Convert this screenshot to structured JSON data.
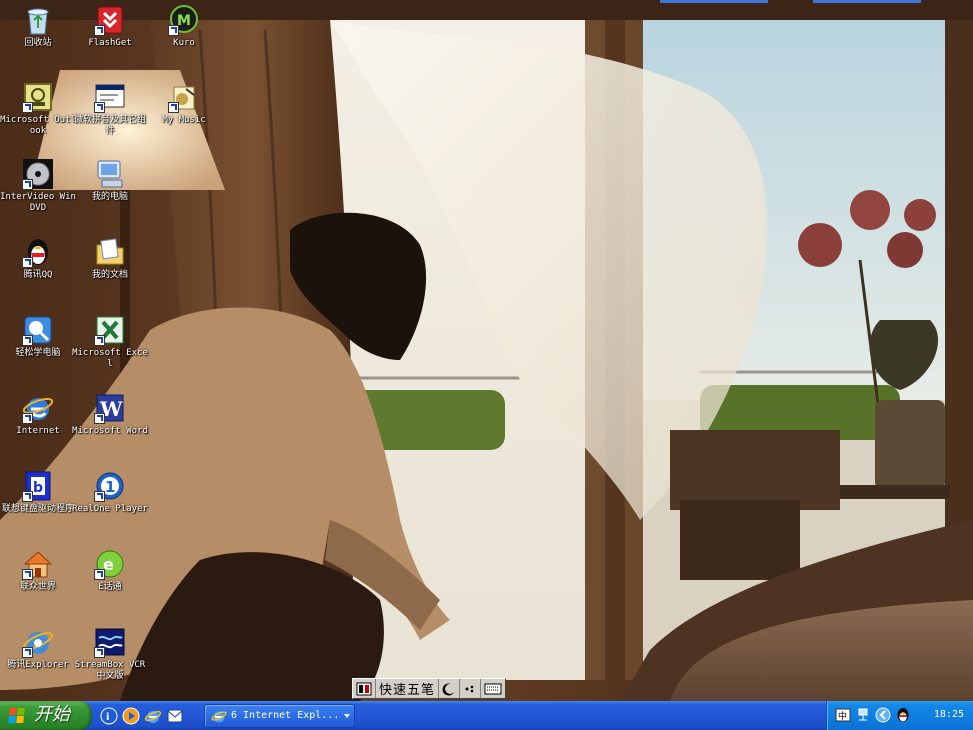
{
  "desktop": {
    "icons": [
      {
        "label": "回收站",
        "icon": "recycle-bin-icon",
        "shortcut": false
      },
      {
        "label": "FlashGet",
        "icon": "flashget-icon",
        "shortcut": true
      },
      {
        "label": "Kuro",
        "icon": "kuro-icon",
        "shortcut": true
      },
      {
        "label": "Microsoft Outlook",
        "icon": "outlook-icon",
        "shortcut": true
      },
      {
        "label": "微软拼音及其它组件",
        "icon": "ime-setup-icon",
        "shortcut": true
      },
      {
        "label": "My Music",
        "icon": "my-music-icon",
        "shortcut": true
      },
      {
        "label": "InterVideo WinDVD",
        "icon": "windvd-icon",
        "shortcut": true
      },
      {
        "label": "我的电脑",
        "icon": "my-computer-icon",
        "shortcut": false
      },
      {
        "label": "腾讯QQ",
        "icon": "qq-penguin-icon",
        "shortcut": true
      },
      {
        "label": "我的文档",
        "icon": "my-documents-icon",
        "shortcut": false
      },
      {
        "label": "轻松学电脑",
        "icon": "learn-computer-icon",
        "shortcut": true
      },
      {
        "label": "Microsoft Excel",
        "icon": "excel-icon",
        "shortcut": true
      },
      {
        "label": "Internet",
        "icon": "internet-explorer-icon",
        "shortcut": true
      },
      {
        "label": "Microsoft Word",
        "icon": "word-icon",
        "shortcut": true
      },
      {
        "label": "联想键盘驱动程序",
        "icon": "keyboard-driver-icon",
        "shortcut": true
      },
      {
        "label": "RealOne Player",
        "icon": "realone-icon",
        "shortcut": true
      },
      {
        "label": "联众世界",
        "icon": "ourgame-house-icon",
        "shortcut": true
      },
      {
        "label": "E话通",
        "icon": "ehuatong-icon",
        "shortcut": true
      },
      {
        "label": "腾讯Explorer",
        "icon": "tencent-explorer-icon",
        "shortcut": true
      },
      {
        "label": "StreamBox VCR 中文版",
        "icon": "streambox-icon",
        "shortcut": true
      }
    ]
  },
  "ime_bar": {
    "name": "快速五笔",
    "icons": [
      "ime-logo-icon",
      "half-moon-icon",
      "punctuation-icon",
      "soft-keyboard-icon"
    ]
  },
  "taskbar": {
    "start_label": "开始",
    "quick_launch": [
      "qq-launch-icon",
      "media-player-icon",
      "internet-explorer-icon",
      "outlook-express-icon"
    ],
    "task_button_label": "6 Internet Expl...",
    "tray_icons": [
      "input-method-icon",
      "network-icon",
      "arrow-icon",
      "qq-penguin-icon"
    ],
    "clock": "18:25"
  },
  "colors": {
    "taskbar": "#245edb",
    "start_button": "#3c9d3a",
    "tray": "#0f80e2"
  }
}
